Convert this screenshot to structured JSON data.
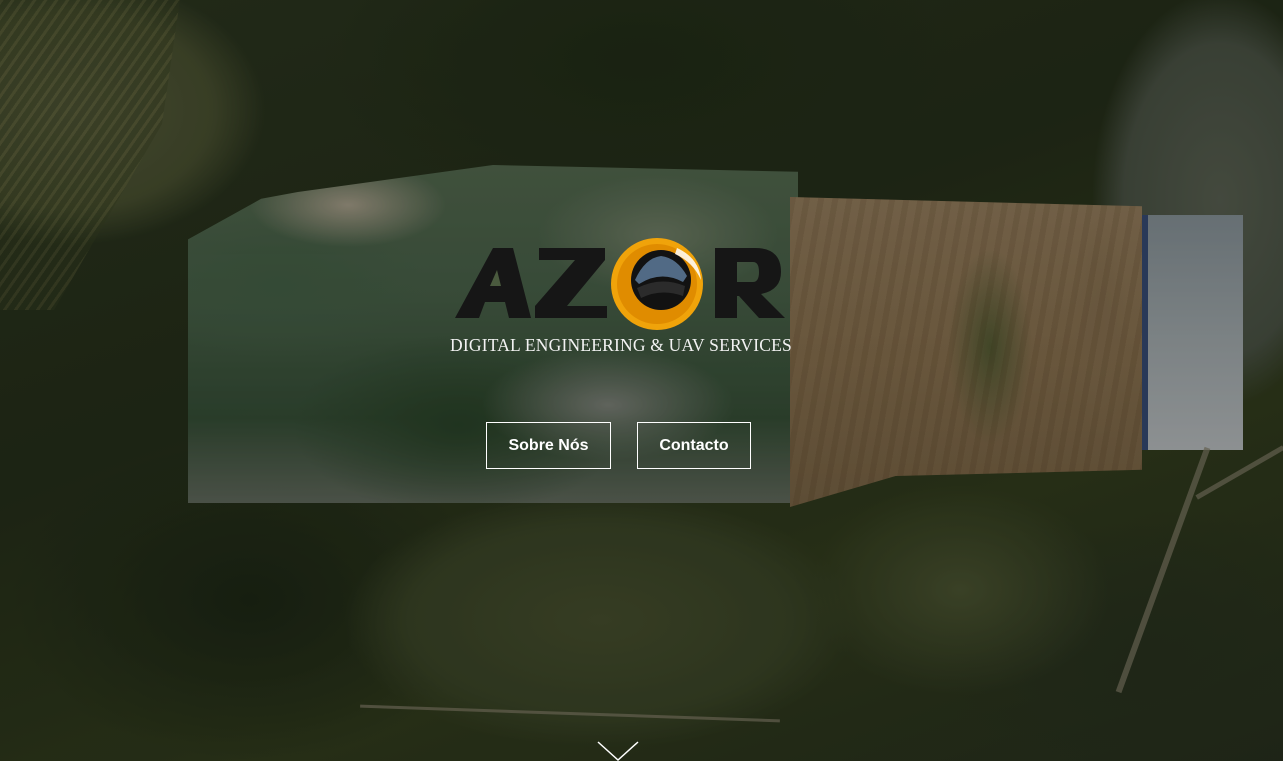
{
  "brand": {
    "logo_text": "AZOR",
    "tagline": "DIGITAL ENGINEERING & UAV SERVICES",
    "accent_color": "#f0a30a",
    "logo_color": "#161616"
  },
  "hero": {
    "buttons": {
      "about_label": "Sobre Nós",
      "contact_label": "Contacto"
    },
    "scroll_icon": "chevron-down-icon"
  }
}
